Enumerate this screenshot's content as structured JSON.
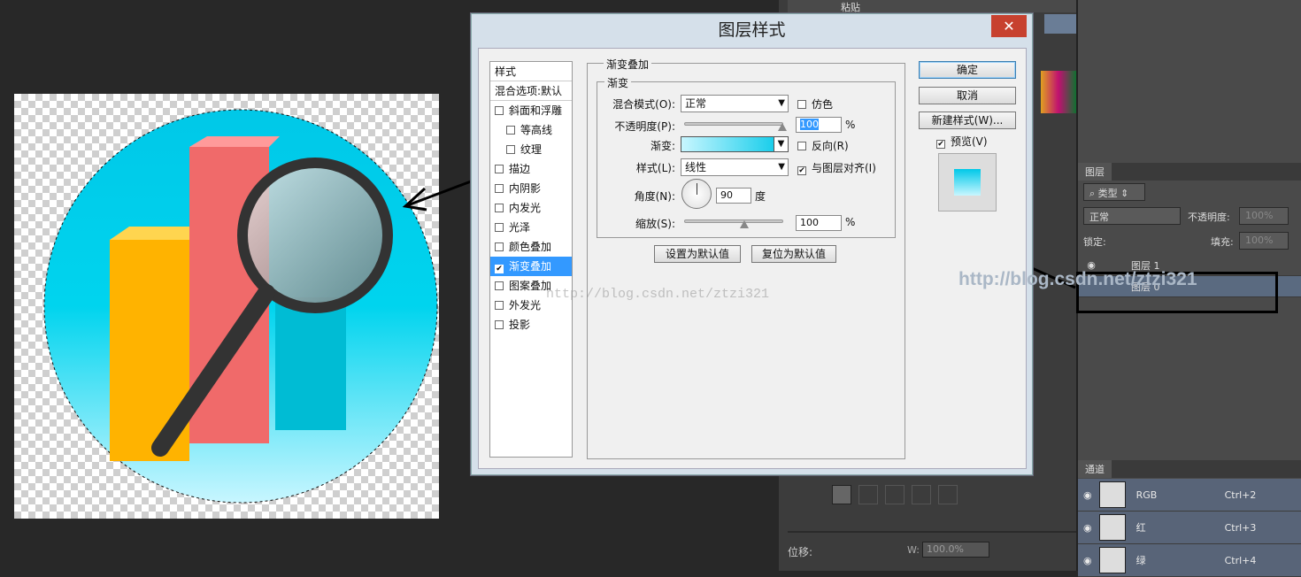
{
  "dialog": {
    "title": "图层样式",
    "close_label": "✕",
    "style_list": {
      "header": "样式",
      "blend_options": "混合选项:默认",
      "items": [
        {
          "label": "斜面和浮雕",
          "checked": false,
          "indent": false
        },
        {
          "label": "等高线",
          "checked": false,
          "indent": true
        },
        {
          "label": "纹理",
          "checked": false,
          "indent": true
        },
        {
          "label": "描边",
          "checked": false,
          "indent": false
        },
        {
          "label": "内阴影",
          "checked": false,
          "indent": false
        },
        {
          "label": "内发光",
          "checked": false,
          "indent": false
        },
        {
          "label": "光泽",
          "checked": false,
          "indent": false
        },
        {
          "label": "颜色叠加",
          "checked": false,
          "indent": false
        },
        {
          "label": "渐变叠加",
          "checked": true,
          "indent": false,
          "selected": true
        },
        {
          "label": "图案叠加",
          "checked": false,
          "indent": false
        },
        {
          "label": "外发光",
          "checked": false,
          "indent": false
        },
        {
          "label": "投影",
          "checked": false,
          "indent": false
        }
      ]
    },
    "gradient_overlay": {
      "group_title": "渐变叠加",
      "sub_title": "渐变",
      "blend_mode_label": "混合模式(O):",
      "blend_mode_value": "正常",
      "dither_label": "仿色",
      "opacity_label": "不透明度(P):",
      "opacity_value": "100",
      "percent": "%",
      "gradient_label": "渐变:",
      "reverse_label": "反向(R)",
      "style_label": "样式(L):",
      "style_value": "线性",
      "align_label": "与图层对齐(I)",
      "angle_label": "角度(N):",
      "angle_value": "90",
      "degree": "度",
      "scale_label": "缩放(S):",
      "scale_value": "100",
      "set_default": "设置为默认值",
      "reset_default": "复位为默认值"
    },
    "buttons": {
      "ok": "确定",
      "cancel": "取消",
      "new_style": "新建样式(W)...",
      "preview": "预览(V)"
    },
    "colors": {
      "gradient_start": "#c8f6ff",
      "gradient_end": "#00c8e8"
    }
  },
  "right_panel": {
    "paste_label": "粘贴",
    "layers_tab": "图层",
    "filter_label": "类型",
    "blend_mode": "正常",
    "opacity_label": "不透明度:",
    "opacity_value": "100%",
    "lock_label": "锁定:",
    "fill_label": "填充:",
    "fill_value": "100%",
    "layers": [
      "图层 1",
      "图层 0"
    ],
    "channels_tab": "通道",
    "channels": [
      {
        "name": "RGB",
        "shortcut": "Ctrl+2"
      },
      {
        "name": "红",
        "shortcut": "Ctrl+3"
      },
      {
        "name": "绿",
        "shortcut": "Ctrl+4"
      }
    ]
  },
  "mid_panel": {
    "offset_label": "位移:",
    "w_label": "W:",
    "w_value": "100.0%"
  },
  "watermark": "http://blog.csdn.net/ztzi321",
  "watermark_faint": "http://blog.csdn.net/ztzi321"
}
